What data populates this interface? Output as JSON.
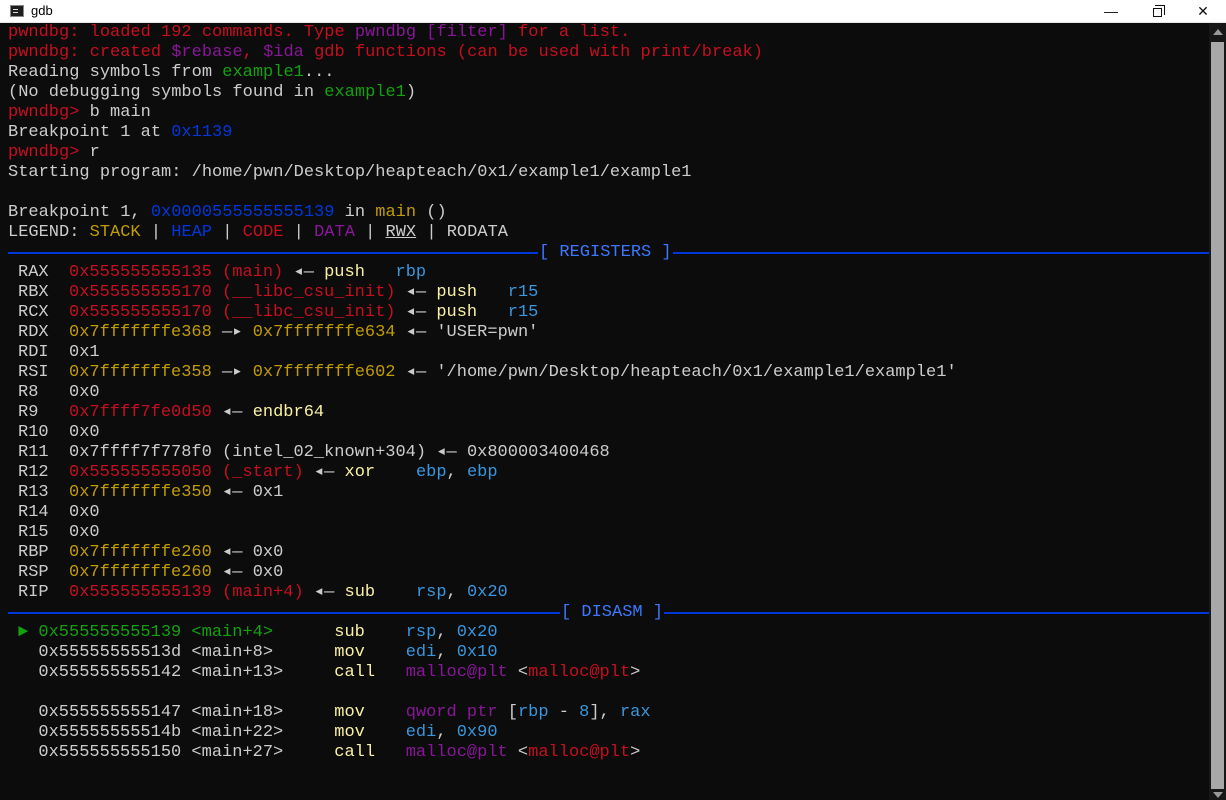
{
  "window": {
    "title": "gdb",
    "controls": {
      "minimize": "—",
      "maximize": "",
      "close": "✕"
    }
  },
  "palette": {
    "bg": "#0c0c0c",
    "fg": "#cccccc",
    "red": "#c50f1f",
    "green": "#13a10e",
    "yellow": "#c19c00",
    "blue": "#0037da",
    "purple": "#881798",
    "cyan": "#3a96dd",
    "bright_blue": "#3b78ff",
    "bright_yellow": "#f9f1a5"
  },
  "terminal": {
    "lines": [
      {
        "segments": [
          {
            "t": "pwndbg: loaded 192 commands. Type ",
            "c": "red"
          },
          {
            "t": "pwndbg [filter]",
            "c": "purple"
          },
          {
            "t": " for a list.",
            "c": "red"
          }
        ]
      },
      {
        "segments": [
          {
            "t": "pwndbg: created ",
            "c": "red"
          },
          {
            "t": "$rebase",
            "c": "purple"
          },
          {
            "t": ", ",
            "c": "red"
          },
          {
            "t": "$ida",
            "c": "purple"
          },
          {
            "t": " gdb functions (can be used with print/break)",
            "c": "red"
          }
        ]
      },
      {
        "segments": [
          {
            "t": "Reading symbols from ",
            "c": "fg"
          },
          {
            "t": "example1",
            "c": "green"
          },
          {
            "t": "...",
            "c": "fg"
          }
        ]
      },
      {
        "segments": [
          {
            "t": "(No debugging symbols found in ",
            "c": "fg"
          },
          {
            "t": "example1",
            "c": "green"
          },
          {
            "t": ")",
            "c": "fg"
          }
        ]
      },
      {
        "segments": [
          {
            "t": "pwndbg> ",
            "c": "red"
          },
          {
            "t": "b main",
            "c": "fg"
          }
        ]
      },
      {
        "segments": [
          {
            "t": "Breakpoint 1 at ",
            "c": "fg"
          },
          {
            "t": "0x1139",
            "c": "blue"
          }
        ]
      },
      {
        "segments": [
          {
            "t": "pwndbg> ",
            "c": "red"
          },
          {
            "t": "r",
            "c": "fg"
          }
        ]
      },
      {
        "segments": [
          {
            "t": "Starting program: /home/pwn/Desktop/heapteach/0x1/example1/example1",
            "c": "fg"
          }
        ]
      },
      {
        "segments": [
          {
            "t": "",
            "c": "fg"
          }
        ]
      },
      {
        "segments": [
          {
            "t": "Breakpoint 1, ",
            "c": "fg"
          },
          {
            "t": "0x0000555555555139",
            "c": "blue"
          },
          {
            "t": " in ",
            "c": "fg"
          },
          {
            "t": "main",
            "c": "yellow"
          },
          {
            "t": " ()",
            "c": "fg"
          }
        ]
      },
      {
        "segments": [
          {
            "t": "LEGEND: ",
            "c": "fg"
          },
          {
            "t": "STACK",
            "c": "yellow"
          },
          {
            "t": " | ",
            "c": "fg"
          },
          {
            "t": "HEAP",
            "c": "blue"
          },
          {
            "t": " | ",
            "c": "fg"
          },
          {
            "t": "CODE",
            "c": "red"
          },
          {
            "t": " | ",
            "c": "fg"
          },
          {
            "t": "DATA",
            "c": "purple"
          },
          {
            "t": " | ",
            "c": "fg"
          },
          {
            "t": "RWX",
            "c": "fg",
            "u": true
          },
          {
            "t": " | ",
            "c": "fg"
          },
          {
            "t": "RODATA",
            "c": "fg"
          }
        ]
      },
      {
        "sep": "[ REGISTERS ]",
        "pos": 530
      },
      {
        "indent": true,
        "segments": [
          {
            "t": "RAX  ",
            "c": "fg"
          },
          {
            "t": "0x555555555135",
            "c": "red"
          },
          {
            "t": " (main)",
            "c": "red"
          },
          {
            "t": " ◂— ",
            "c": "fg"
          },
          {
            "t": "push   ",
            "c": "bright_yellow"
          },
          {
            "t": "rbp",
            "c": "cyan"
          }
        ]
      },
      {
        "indent": true,
        "segments": [
          {
            "t": "RBX  ",
            "c": "fg"
          },
          {
            "t": "0x555555555170",
            "c": "red"
          },
          {
            "t": " (__libc_csu_init)",
            "c": "red"
          },
          {
            "t": " ◂— ",
            "c": "fg"
          },
          {
            "t": "push   ",
            "c": "bright_yellow"
          },
          {
            "t": "r15",
            "c": "cyan"
          }
        ]
      },
      {
        "indent": true,
        "segments": [
          {
            "t": "RCX  ",
            "c": "fg"
          },
          {
            "t": "0x555555555170",
            "c": "red"
          },
          {
            "t": " (__libc_csu_init)",
            "c": "red"
          },
          {
            "t": " ◂— ",
            "c": "fg"
          },
          {
            "t": "push   ",
            "c": "bright_yellow"
          },
          {
            "t": "r15",
            "c": "cyan"
          }
        ]
      },
      {
        "indent": true,
        "segments": [
          {
            "t": "RDX  ",
            "c": "fg"
          },
          {
            "t": "0x7fffffffe368",
            "c": "yellow"
          },
          {
            "t": " —▸ ",
            "c": "fg"
          },
          {
            "t": "0x7fffffffe634",
            "c": "yellow"
          },
          {
            "t": " ◂— ",
            "c": "fg"
          },
          {
            "t": "'USER=pwn'",
            "c": "fg"
          }
        ]
      },
      {
        "indent": true,
        "segments": [
          {
            "t": "RDI  ",
            "c": "fg"
          },
          {
            "t": "0x1",
            "c": "fg"
          }
        ]
      },
      {
        "indent": true,
        "segments": [
          {
            "t": "RSI  ",
            "c": "fg"
          },
          {
            "t": "0x7fffffffe358",
            "c": "yellow"
          },
          {
            "t": " —▸ ",
            "c": "fg"
          },
          {
            "t": "0x7fffffffe602",
            "c": "yellow"
          },
          {
            "t": " ◂— ",
            "c": "fg"
          },
          {
            "t": "'/home/pwn/Desktop/heapteach/0x1/example1/example1'",
            "c": "fg"
          }
        ]
      },
      {
        "indent": true,
        "segments": [
          {
            "t": "R8   ",
            "c": "fg"
          },
          {
            "t": "0x0",
            "c": "fg"
          }
        ]
      },
      {
        "indent": true,
        "segments": [
          {
            "t": "R9   ",
            "c": "fg"
          },
          {
            "t": "0x7ffff7fe0d50",
            "c": "red"
          },
          {
            "t": " ◂— ",
            "c": "fg"
          },
          {
            "t": "endbr64",
            "c": "bright_yellow"
          }
        ]
      },
      {
        "indent": true,
        "segments": [
          {
            "t": "R10  ",
            "c": "fg"
          },
          {
            "t": "0x0",
            "c": "fg"
          }
        ]
      },
      {
        "indent": true,
        "segments": [
          {
            "t": "R11  ",
            "c": "fg"
          },
          {
            "t": "0x7ffff7f778f0",
            "c": "fg"
          },
          {
            "t": " (intel_02_known+304)",
            "c": "fg"
          },
          {
            "t": " ◂— ",
            "c": "fg"
          },
          {
            "t": "0x800003400468",
            "c": "fg"
          }
        ]
      },
      {
        "indent": true,
        "segments": [
          {
            "t": "R12  ",
            "c": "fg"
          },
          {
            "t": "0x555555555050",
            "c": "red"
          },
          {
            "t": " (_start)",
            "c": "red"
          },
          {
            "t": " ◂— ",
            "c": "fg"
          },
          {
            "t": "xor    ",
            "c": "bright_yellow"
          },
          {
            "t": "ebp",
            "c": "cyan"
          },
          {
            "t": ", ",
            "c": "fg"
          },
          {
            "t": "ebp",
            "c": "cyan"
          }
        ]
      },
      {
        "indent": true,
        "segments": [
          {
            "t": "R13  ",
            "c": "fg"
          },
          {
            "t": "0x7fffffffe350",
            "c": "yellow"
          },
          {
            "t": " ◂— ",
            "c": "fg"
          },
          {
            "t": "0x1",
            "c": "fg"
          }
        ]
      },
      {
        "indent": true,
        "segments": [
          {
            "t": "R14  ",
            "c": "fg"
          },
          {
            "t": "0x0",
            "c": "fg"
          }
        ]
      },
      {
        "indent": true,
        "segments": [
          {
            "t": "R15  ",
            "c": "fg"
          },
          {
            "t": "0x0",
            "c": "fg"
          }
        ]
      },
      {
        "indent": true,
        "segments": [
          {
            "t": "RBP  ",
            "c": "fg"
          },
          {
            "t": "0x7fffffffe260",
            "c": "yellow"
          },
          {
            "t": " ◂— ",
            "c": "fg"
          },
          {
            "t": "0x0",
            "c": "fg"
          }
        ]
      },
      {
        "indent": true,
        "segments": [
          {
            "t": "RSP  ",
            "c": "fg"
          },
          {
            "t": "0x7fffffffe260",
            "c": "yellow"
          },
          {
            "t": " ◂— ",
            "c": "fg"
          },
          {
            "t": "0x0",
            "c": "fg"
          }
        ]
      },
      {
        "indent": true,
        "segments": [
          {
            "t": "RIP  ",
            "c": "fg"
          },
          {
            "t": "0x555555555139",
            "c": "red"
          },
          {
            "t": " (main+4)",
            "c": "red"
          },
          {
            "t": " ◂— ",
            "c": "fg"
          },
          {
            "t": "sub    ",
            "c": "bright_yellow"
          },
          {
            "t": "rsp",
            "c": "cyan"
          },
          {
            "t": ", ",
            "c": "fg"
          },
          {
            "t": "0x20",
            "c": "cyan"
          }
        ]
      },
      {
        "sep": "[ DISASM ]",
        "pos": 552
      },
      {
        "indent": true,
        "segments": [
          {
            "t": "► ",
            "c": "green"
          },
          {
            "t": "0x555555555139",
            "c": "green"
          },
          {
            "t": " <main+4>",
            "c": "green"
          },
          {
            "t": "      ",
            "c": "fg"
          },
          {
            "t": "sub    ",
            "c": "bright_yellow"
          },
          {
            "t": "rsp",
            "c": "cyan"
          },
          {
            "t": ", ",
            "c": "fg"
          },
          {
            "t": "0x20",
            "c": "cyan"
          }
        ]
      },
      {
        "indent": true,
        "segments": [
          {
            "t": "  0x55555555513d",
            "c": "fg"
          },
          {
            "t": " <main+8>",
            "c": "fg"
          },
          {
            "t": "      ",
            "c": "fg"
          },
          {
            "t": "mov    ",
            "c": "bright_yellow"
          },
          {
            "t": "edi",
            "c": "cyan"
          },
          {
            "t": ", ",
            "c": "fg"
          },
          {
            "t": "0x10",
            "c": "cyan"
          }
        ]
      },
      {
        "indent": true,
        "segments": [
          {
            "t": "  0x555555555142",
            "c": "fg"
          },
          {
            "t": " <main+13>",
            "c": "fg"
          },
          {
            "t": "     ",
            "c": "fg"
          },
          {
            "t": "call   ",
            "c": "bright_yellow"
          },
          {
            "t": "malloc@plt",
            "c": "purple"
          },
          {
            "t": " <",
            "c": "fg"
          },
          {
            "t": "malloc@plt",
            "c": "red"
          },
          {
            "t": ">",
            "c": "fg"
          }
        ]
      },
      {
        "segments": [
          {
            "t": "",
            "c": "fg"
          }
        ]
      },
      {
        "indent": true,
        "segments": [
          {
            "t": "  0x555555555147",
            "c": "fg"
          },
          {
            "t": " <main+18>",
            "c": "fg"
          },
          {
            "t": "     ",
            "c": "fg"
          },
          {
            "t": "mov    ",
            "c": "bright_yellow"
          },
          {
            "t": "qword ptr ",
            "c": "purple"
          },
          {
            "t": "[",
            "c": "fg"
          },
          {
            "t": "rbp",
            "c": "cyan"
          },
          {
            "t": " - ",
            "c": "fg"
          },
          {
            "t": "8",
            "c": "cyan"
          },
          {
            "t": "], ",
            "c": "fg"
          },
          {
            "t": "rax",
            "c": "cyan"
          }
        ]
      },
      {
        "indent": true,
        "segments": [
          {
            "t": "  0x55555555514b",
            "c": "fg"
          },
          {
            "t": " <main+22>",
            "c": "fg"
          },
          {
            "t": "     ",
            "c": "fg"
          },
          {
            "t": "mov    ",
            "c": "bright_yellow"
          },
          {
            "t": "edi",
            "c": "cyan"
          },
          {
            "t": ", ",
            "c": "fg"
          },
          {
            "t": "0x90",
            "c": "cyan"
          }
        ]
      },
      {
        "indent": true,
        "segments": [
          {
            "t": "  0x555555555150",
            "c": "fg"
          },
          {
            "t": " <main+27>",
            "c": "fg"
          },
          {
            "t": "     ",
            "c": "fg"
          },
          {
            "t": "call   ",
            "c": "bright_yellow"
          },
          {
            "t": "malloc@plt",
            "c": "purple"
          },
          {
            "t": " <",
            "c": "fg"
          },
          {
            "t": "malloc@plt",
            "c": "red"
          },
          {
            "t": ">",
            "c": "fg"
          }
        ]
      }
    ]
  }
}
